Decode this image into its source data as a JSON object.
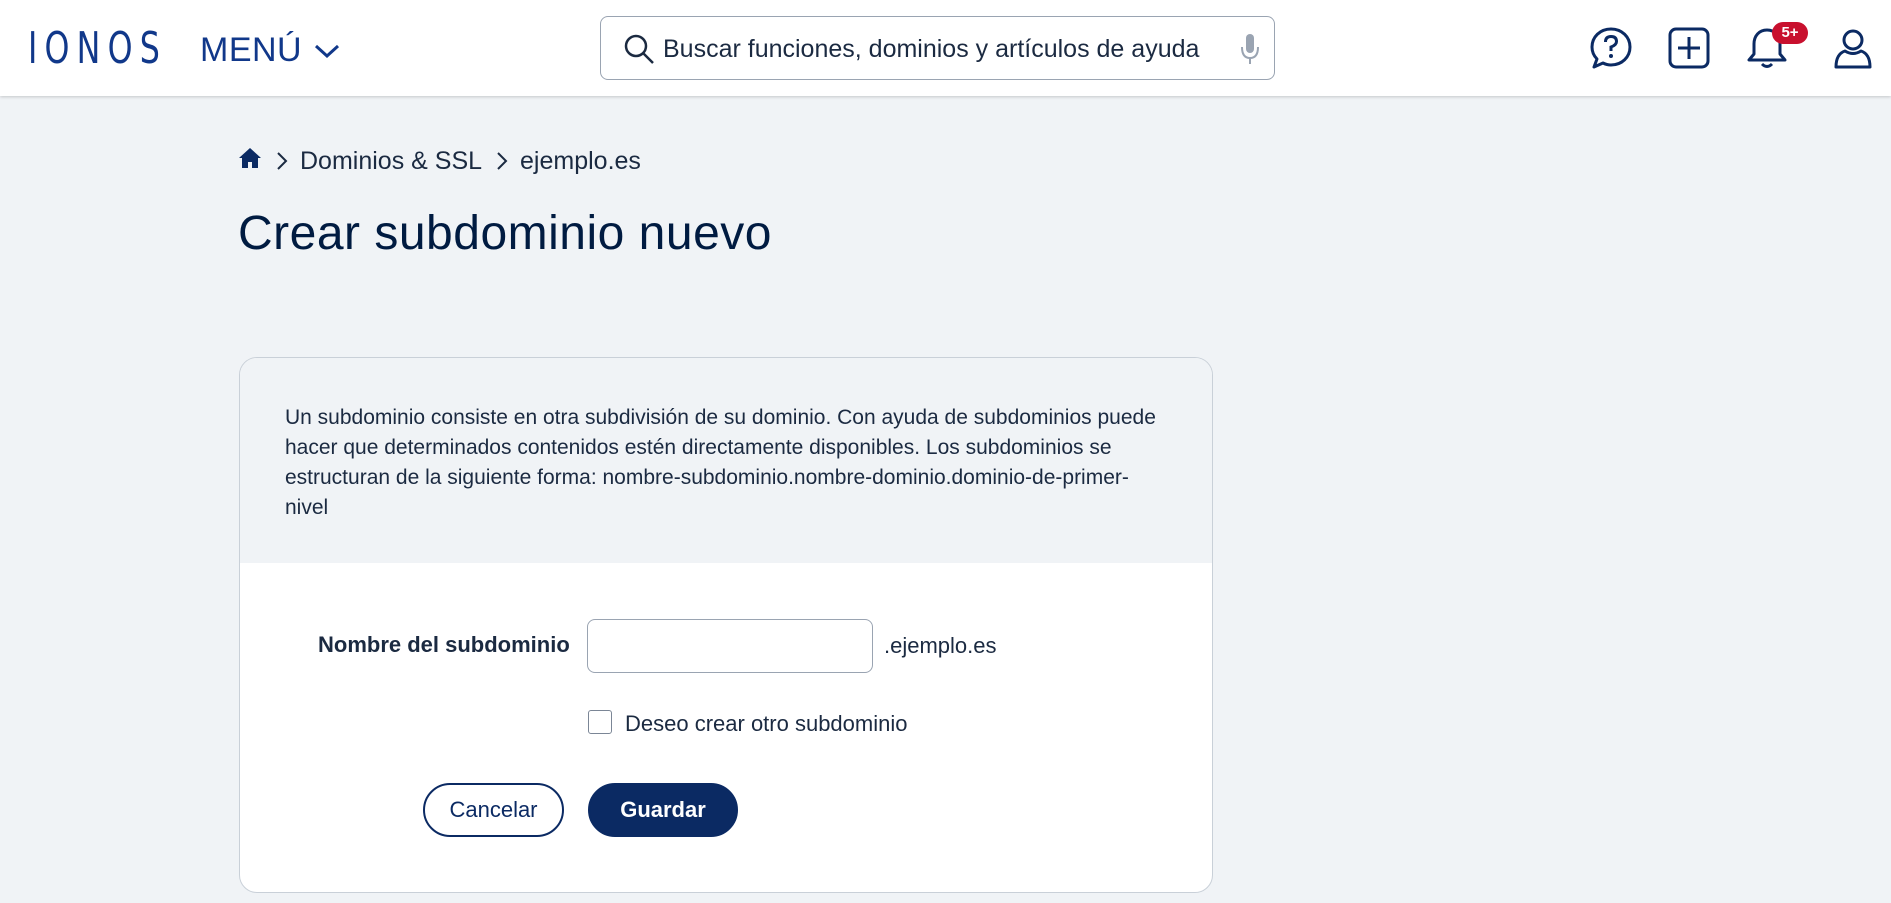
{
  "header": {
    "logo": "IONOS",
    "menu_label": "MENÚ",
    "search_placeholder": "Buscar funciones, dominios y artículos de ayuda",
    "notifications_badge": "5+"
  },
  "breadcrumb": {
    "items": [
      "Dominios & SSL",
      "ejemplo.es"
    ]
  },
  "page": {
    "title": "Crear subdominio nuevo"
  },
  "card": {
    "description": "Un subdominio consiste en otra subdivisión de su dominio. Con ayuda de subdominios puede hacer que determinados contenidos estén directamente disponibles. Los subdominios se estructuran de la siguiente forma: nombre-subdominio.nombre-dominio.dominio-de-primer-nivel",
    "subdomain_label": "Nombre del subdominio",
    "subdomain_value": "",
    "domain_suffix": ".ejemplo.es",
    "another_checkbox_label": "Deseo crear otro subdominio",
    "another_checked": false,
    "cancel_label": "Cancelar",
    "save_label": "Guardar"
  },
  "colors": {
    "brand": "#11388a",
    "primary_button": "#0b2a63",
    "badge": "#c8102e",
    "background": "#f0f3f6"
  },
  "icons": [
    "home-icon",
    "chevron-right-icon",
    "chevron-down-icon",
    "search-icon",
    "microphone-icon",
    "help-chat-icon",
    "add-icon",
    "bell-icon",
    "user-icon"
  ]
}
